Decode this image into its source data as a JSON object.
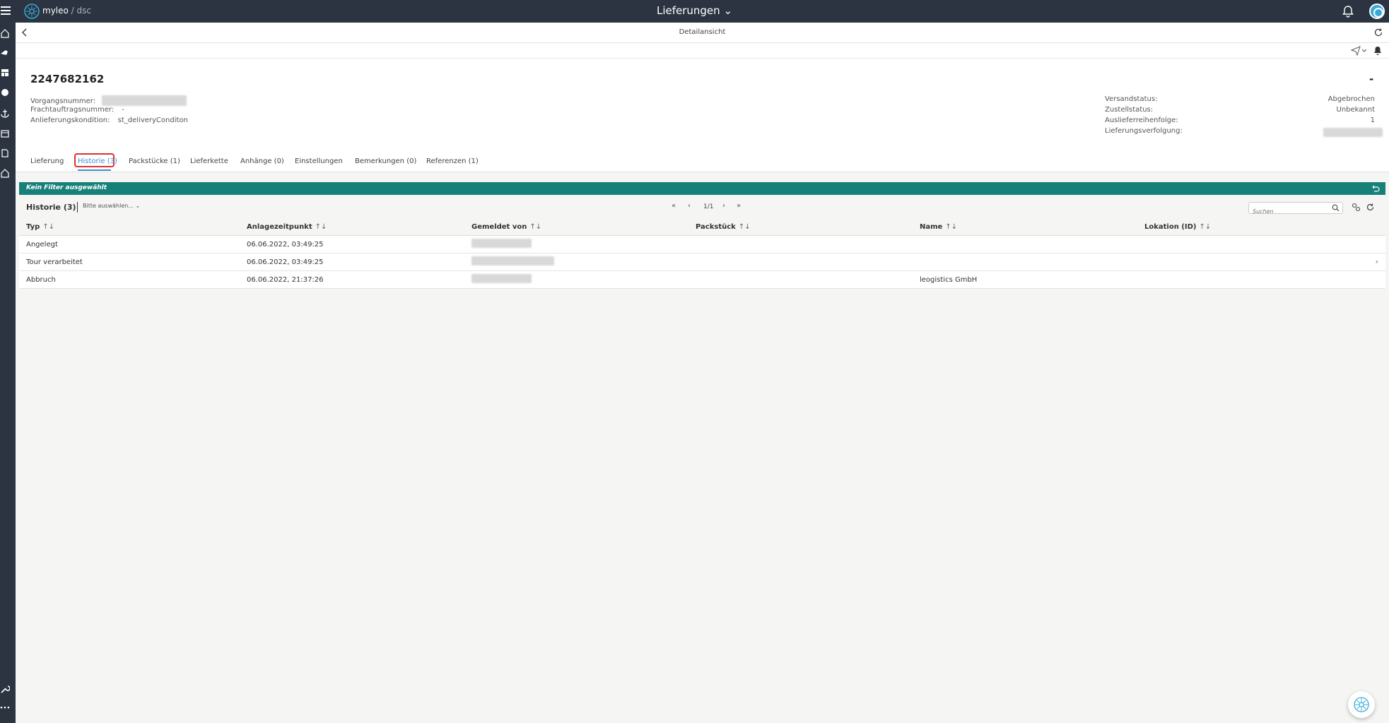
{
  "app": {
    "brand_main": "myleo",
    "brand_sep": " / ",
    "brand_sub": "dsc",
    "title": "Lieferungen"
  },
  "subheader": {
    "title": "Detailansicht"
  },
  "delivery": {
    "id": "2247682162",
    "right_dash": "-",
    "vorgangsnummer_label": "Vorgangsnummer:",
    "frachtauftrag_label": "Frachtauftragsnummer:",
    "frachtauftrag_value": "-",
    "anlieferung_label": "Anlieferungskondition:",
    "anlieferung_value": "st_deliveryConditon",
    "versandstatus_label": "Versandstatus:",
    "versandstatus_value": "Abgebrochen",
    "zustellstatus_label": "Zustellstatus:",
    "zustellstatus_value": "Unbekannt",
    "reihenfolge_label": "Auslieferreihenfolge:",
    "reihenfolge_value": "1",
    "verfolgung_label": "Lieferungsverfolgung:"
  },
  "tabs": [
    {
      "label": "Lieferung"
    },
    {
      "label": "Historie (3)"
    },
    {
      "label": "Packstücke (1)"
    },
    {
      "label": "Lieferkette"
    },
    {
      "label": "Anhänge (0)"
    },
    {
      "label": "Einstellungen"
    },
    {
      "label": "Bemerkungen (0)"
    },
    {
      "label": "Referenzen (1)"
    }
  ],
  "filter": {
    "text": "Kein Filter ausgewählt"
  },
  "list": {
    "title": "Historie (3)",
    "select_placeholder": "Bitte auswählen...",
    "pager_text": "1/1",
    "search_placeholder": "Suchen"
  },
  "table": {
    "columns": [
      "Typ",
      "Anlagezeitpunkt",
      "Gemeldet von",
      "Packstück",
      "Name",
      "Lokation (ID)"
    ],
    "sort_glyph": "↑↓",
    "rows": [
      {
        "typ": "Angelegt",
        "zeit": "06.06.2022, 03:49:25",
        "name": ""
      },
      {
        "typ": "Tour verarbeitet",
        "zeit": "06.06.2022, 03:49:25",
        "name": ""
      },
      {
        "typ": "Abbruch",
        "zeit": "06.06.2022, 21:37:26",
        "name": "leogistics GmbH"
      }
    ]
  },
  "colors": {
    "topbar": "#2b3440",
    "accent": "#168079",
    "tab_active": "#3a8fd0",
    "highlight": "#e0302d"
  },
  "icons": [
    "menu-icon",
    "logo-icon",
    "bell-icon",
    "avatar-icon",
    "back-icon",
    "reload-icon",
    "send-icon",
    "filter-reset-icon",
    "search-icon",
    "chevron-right-icon",
    "assistant-icon"
  ]
}
